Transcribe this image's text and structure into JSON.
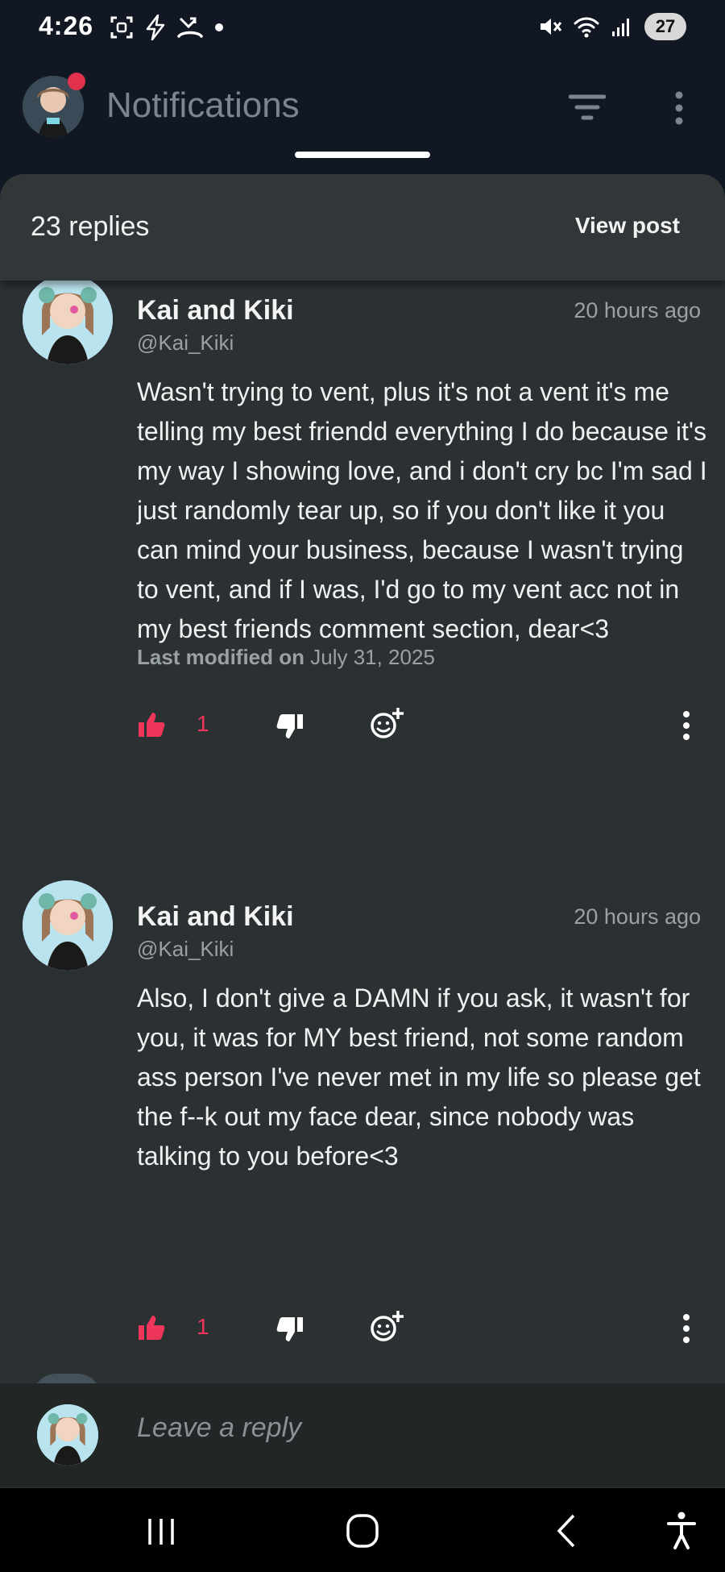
{
  "status_bar": {
    "time": "4:26",
    "battery": "27",
    "left_icons": [
      "screenshot-icon",
      "bolt-icon",
      "missed-call-icon",
      "dot-icon"
    ],
    "right_icons": [
      "mute-icon",
      "wifi-icon",
      "signal-icon",
      "battery-icon"
    ]
  },
  "header": {
    "title": "Notifications",
    "icons": [
      "avatar",
      "filter-icon",
      "more-vert-icon"
    ]
  },
  "sheet": {
    "reply_count": "23 replies",
    "view_post": "View post"
  },
  "comments": [
    {
      "name": "Kai and Kiki",
      "handle": "@Kai_Kiki",
      "time": "20 hours ago",
      "body": "Wasn't trying to vent, plus it's not a vent it's me telling my best friendd everything I do because it's my way I showing love, and i don't cry bc I'm sad I just randomly tear up, so if you don't like it you can mind your business, because I wasn't trying to vent, and if I was, I'd go to my vent acc not in my best friends comment section, dear<3",
      "modified_label": "Last modified on",
      "modified_date": "July 31, 2025",
      "likes": "1"
    },
    {
      "name": "Kai and Kiki",
      "handle": "@Kai_Kiki",
      "time": "20 hours ago",
      "body": "Also, I don't give a DAMN if you ask, it wasn't for you, it was for MY best friend, not some random ass person I've never met in my life so please get the f--k out my face dear, since nobody was talking to you before<3",
      "likes": "1"
    }
  ],
  "reply_bar": {
    "placeholder": "Leave a reply"
  },
  "colors": {
    "accent": "#f0355b",
    "background": "#121823",
    "sheet": "#2b3033",
    "notification_dot": "#e0324c"
  },
  "nav_bar": {
    "icons": [
      "recents-icon",
      "home-icon",
      "back-icon",
      "accessibility-icon"
    ]
  }
}
